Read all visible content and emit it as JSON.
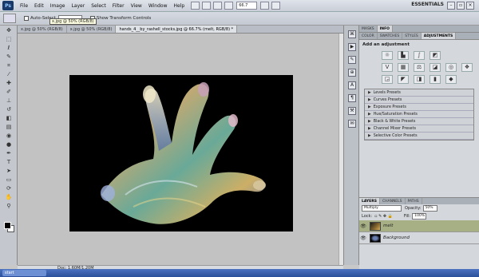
{
  "menubar": {
    "logo": "Ps",
    "items": [
      "File",
      "Edit",
      "Image",
      "Layer",
      "Select",
      "Filter",
      "View",
      "Window",
      "Help"
    ],
    "zoom": "66.7",
    "workspace": "ESSENTIALS"
  },
  "options": {
    "auto_select": "Auto-Select",
    "show_transform": "Show Transform Controls",
    "tooltip": "x.jpg @ 50% (RGB/8)"
  },
  "doc_tabs": [
    "x.jpg @ 50% (RGB/8)",
    "x.jpg @ 50% (RGB/8)",
    "hands_4__by_rashell_stocks.jpg @ 66.7% (melt, RGB/8) *"
  ],
  "status": {
    "doc_size": "Doc: 1.60M/1.20M"
  },
  "panels": {
    "top_tabs": [
      "MASKS",
      "INFO"
    ],
    "tabs": [
      "COLOR",
      "SWATCHES",
      "STYLES",
      "ADJUSTMENTS"
    ],
    "adj_title": "Add an adjustment",
    "adj_icons": [
      "brightness-icon",
      "levels-icon",
      "curves-icon",
      "exposure-icon",
      "vibrance-icon",
      "hue-sat-icon",
      "color-balance-icon",
      "bw-icon",
      "photo-filter-icon",
      "channel-mixer-icon",
      "invert-icon",
      "posterize-icon",
      "threshold-icon",
      "gradient-map-icon",
      "selective-color-icon"
    ],
    "presets": [
      "Levels Presets",
      "Curves Presets",
      "Exposure Presets",
      "Hue/Saturation Presets",
      "Black & White Presets",
      "Channel Mixer Presets",
      "Selective Color Presets"
    ]
  },
  "layers": {
    "tabs": [
      "LAYERS",
      "CHANNELS",
      "PATHS"
    ],
    "blend_mode": "Multiply",
    "opacity_label": "Opacity:",
    "opacity": "50%",
    "lock_label": "Lock:",
    "fill_label": "Fill:",
    "fill": "100%",
    "items": [
      {
        "name": "melt",
        "selected": true
      },
      {
        "name": "Background",
        "selected": false
      }
    ]
  },
  "taskbar": {
    "task": "start"
  }
}
